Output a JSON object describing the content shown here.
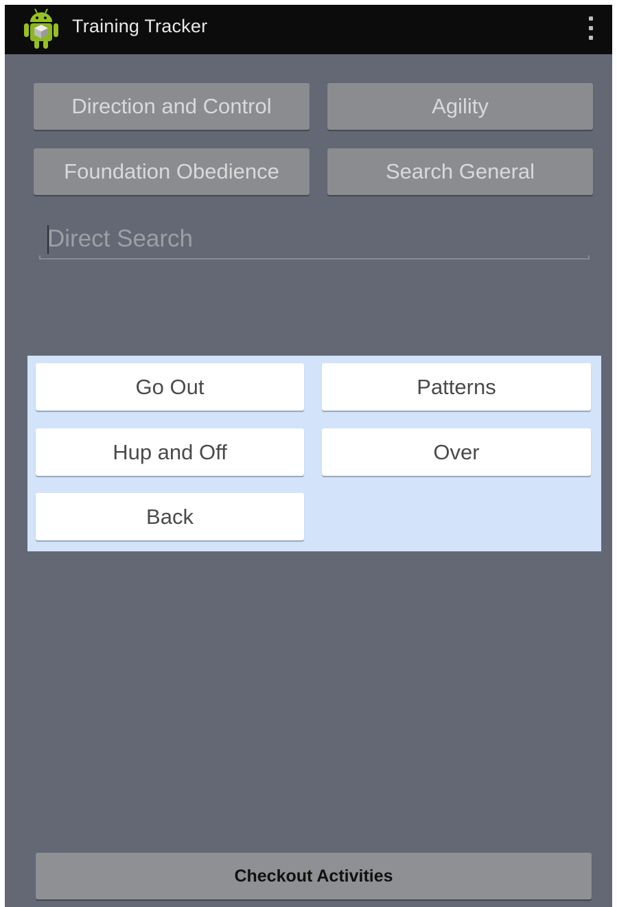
{
  "action_bar": {
    "title": "Training Tracker",
    "app_icon": "android-robot-icon",
    "overflow_icon": "overflow-menu-icon"
  },
  "category_buttons": [
    {
      "label": "Direction and Control"
    },
    {
      "label": "Agility"
    },
    {
      "label": "Foundation Obedience"
    },
    {
      "label": "Search General"
    }
  ],
  "search": {
    "value": "",
    "placeholder": "Direct Search"
  },
  "popup_buttons": [
    {
      "label": "Go Out"
    },
    {
      "label": "Patterns"
    },
    {
      "label": "Hup and Off"
    },
    {
      "label": "Over"
    },
    {
      "label": "Back"
    }
  ],
  "footer": {
    "checkout_label": "Checkout Activities"
  },
  "colors": {
    "background": "#636874",
    "action_bar": "#0c0c0c",
    "popup": "#d2e3fa",
    "android_green": "#97c024"
  }
}
